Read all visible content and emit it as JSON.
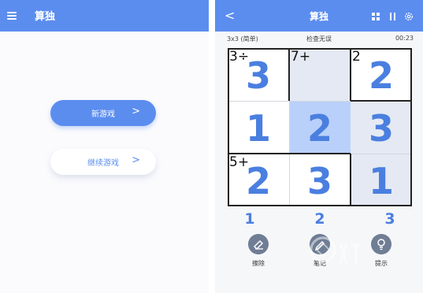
{
  "colors": {
    "accent": "#5b8def",
    "digit": "#4a7fe0",
    "selected": "#b9d0fb",
    "highlight": "#e4e9f3"
  },
  "left": {
    "appbar": {
      "menu_icon": "hamburger-icon",
      "title": "算独"
    },
    "new_game": {
      "label": "新游戏",
      "chevron": ">"
    },
    "continue_game": {
      "label": "继续游戏",
      "chevron": ">"
    }
  },
  "right": {
    "appbar": {
      "back": "<",
      "title": "算独",
      "icons": [
        "grid-icon",
        "pause-icon",
        "gear-icon"
      ]
    },
    "status": {
      "mode": "3x3 (简单)",
      "check": "检查无误",
      "time": "00:23"
    },
    "board": {
      "cells": [
        {
          "clue": "3÷",
          "value": "3"
        },
        {
          "clue": "7+",
          "value": ""
        },
        {
          "clue": "2",
          "value": "2"
        },
        {
          "clue": "",
          "value": "1"
        },
        {
          "clue": "",
          "value": "2"
        },
        {
          "clue": "",
          "value": "3"
        },
        {
          "clue": "5+",
          "value": "2"
        },
        {
          "clue": "",
          "value": "3"
        },
        {
          "clue": "",
          "value": "1"
        }
      ]
    },
    "number_pad": [
      "1",
      "2",
      "3"
    ],
    "tools": [
      {
        "label": "擦除",
        "icon": "eraser-icon"
      },
      {
        "label": "笔记",
        "icon": "pencil-icon"
      },
      {
        "label": "提示",
        "icon": "hint-icon"
      }
    ]
  }
}
